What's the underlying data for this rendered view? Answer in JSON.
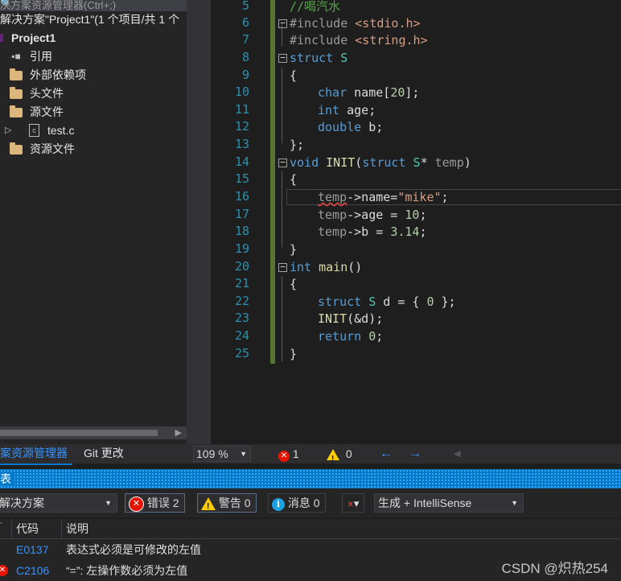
{
  "explorer": {
    "search_placeholder": "决方案资源管理器(Ctrl+;)",
    "solution_label": "解决方案\"Project1\"(1 个项目/共 1 个",
    "project": "Project1",
    "items": [
      {
        "label": "引用",
        "icon": "references-icon"
      },
      {
        "label": "外部依赖项",
        "icon": "external-deps-icon"
      },
      {
        "label": "头文件",
        "icon": "folder-icon"
      },
      {
        "label": "源文件",
        "icon": "folder-icon"
      },
      {
        "label": "test.c",
        "icon": "c-file-icon"
      },
      {
        "label": "资源文件",
        "icon": "folder-icon"
      }
    ],
    "tabs": [
      "案资源管理器",
      "Git 更改"
    ]
  },
  "editor": {
    "line_numbers": [
      "5",
      "6",
      "7",
      "8",
      "9",
      "10",
      "11",
      "12",
      "13",
      "14",
      "15",
      "16",
      "17",
      "18",
      "19",
      "20",
      "21",
      "22",
      "23",
      "24",
      "25"
    ],
    "comment_top": "//喝汽水",
    "zoom": "109 %",
    "error_count": "1",
    "warning_count": "0"
  },
  "errorlist": {
    "title": "表",
    "scope": "解决方案",
    "errors_btn": "错误 2",
    "warnings_btn": "警告 0",
    "messages_btn": "消息 0",
    "build_filter": "生成 + IntelliSense",
    "col_code": "代码",
    "col_desc": "说明",
    "rows": [
      {
        "code": "E0137",
        "desc": "表达式必须是可修改的左值"
      },
      {
        "code": "C2106",
        "desc": "“=”: 左操作数必须为左值"
      }
    ]
  },
  "watermark": "CSDN @炽热254",
  "colors": {
    "accent": "#007acc",
    "keyword": "#569cd6",
    "comment": "#57a64a",
    "string": "#d69d85",
    "change_bar": "#577430"
  }
}
